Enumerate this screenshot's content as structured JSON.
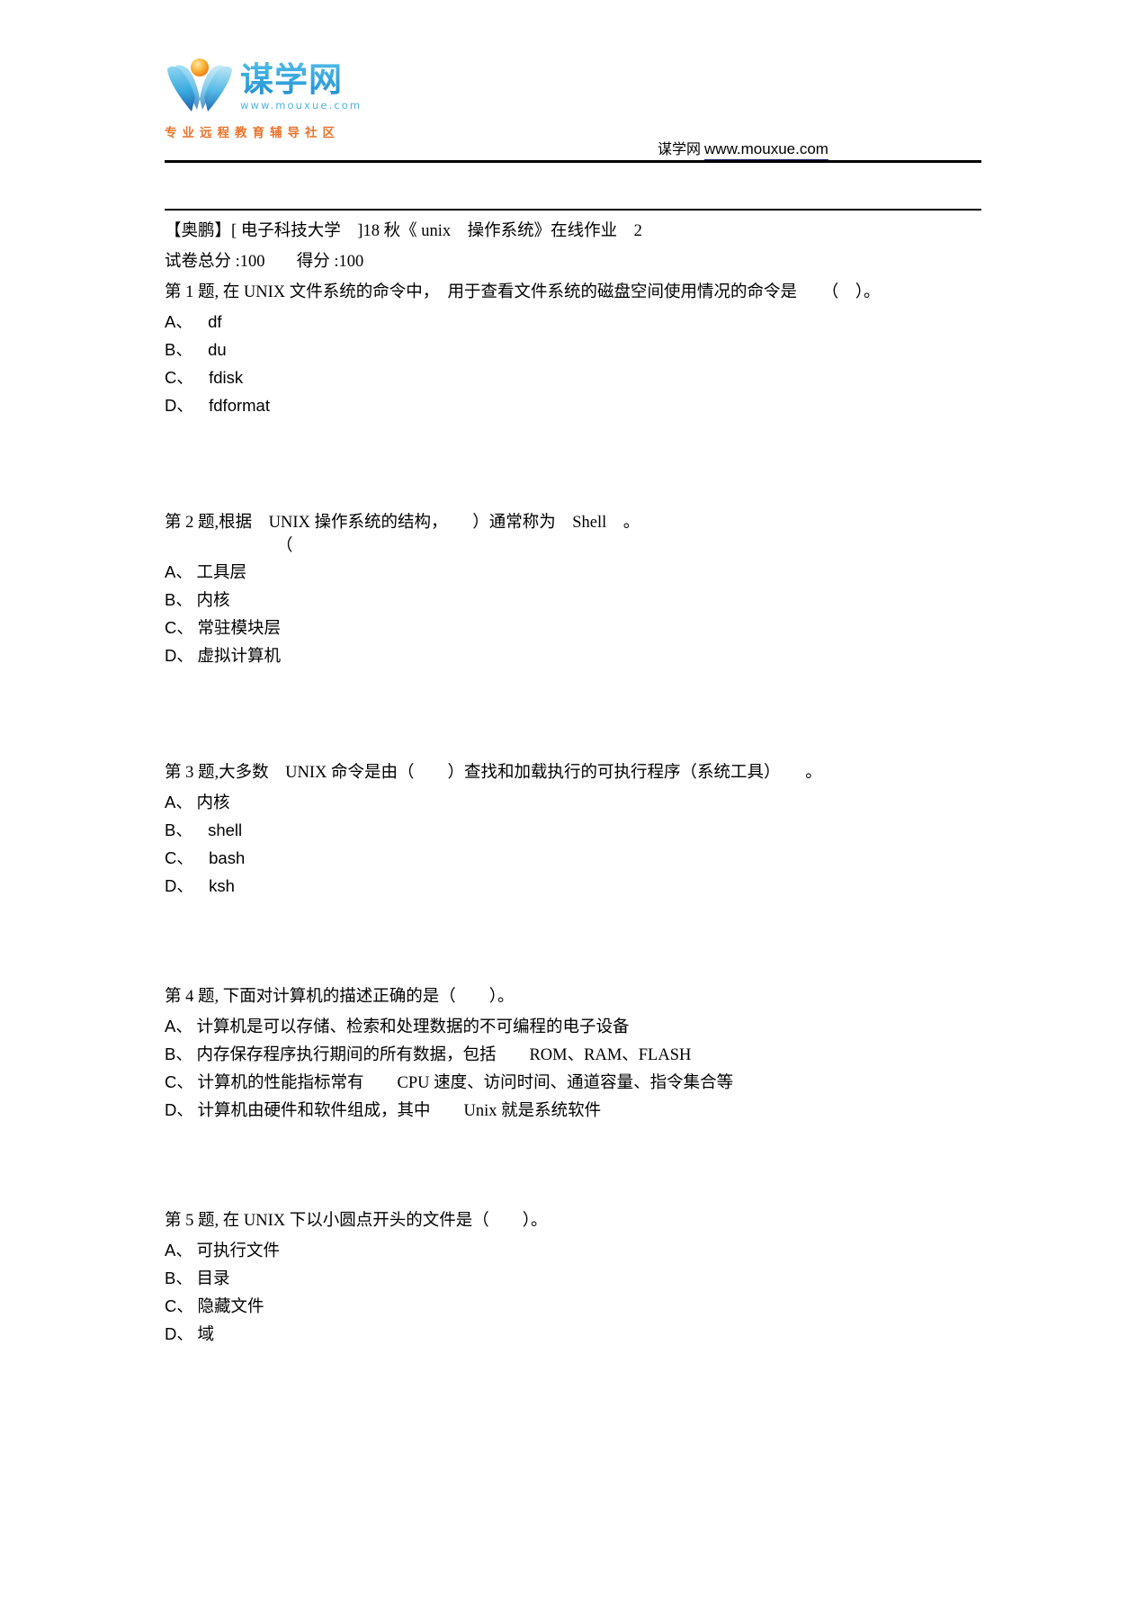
{
  "header": {
    "logo_text": "谋学网",
    "logo_url": "www.mouxue.com",
    "logo_tagline": "专业远程教育辅导社区",
    "right_site_cn": "谋学网",
    "right_site_url": "www.mouxue.com",
    "brand_color": "#29a3dc",
    "tagline_color": "#e8742c",
    "underline_color": "#1d1d6b"
  },
  "doc": {
    "title": "【奥鹏】[ 电子科技大学　]18 秋《 unix　操作系统》在线作业　2",
    "total_label": "试卷总分 :100",
    "gain_label": "得分 :100"
  },
  "questions": [
    {
      "stem": "第 1 题, 在 UNIX 文件系统的命令中，　用于查看文件系统的磁盘空间使用情况的命令是　　（　）。",
      "stem_line2": "",
      "options": [
        {
          "letter": "A、",
          "text": "df"
        },
        {
          "letter": "B、",
          "text": "du"
        },
        {
          "letter": "C、",
          "text": "fdisk"
        },
        {
          "letter": "D、",
          "text": "fdformat"
        }
      ]
    },
    {
      "stem": "第 2 题,根据　UNIX 操作系统的结构，　　）通常称为　Shell　。",
      "stem_line2": "（",
      "options": [
        {
          "letter": "A、",
          "text": "工具层"
        },
        {
          "letter": "B、",
          "text": "内核"
        },
        {
          "letter": "C、",
          "text": "常驻模块层"
        },
        {
          "letter": "D、",
          "text": "虚拟计算机"
        }
      ]
    },
    {
      "stem": "第 3 题,大多数　UNIX 命令是由（　　）查找和加载执行的可执行程序（系统工具）　　。",
      "stem_line2": "",
      "options": [
        {
          "letter": "A、",
          "text": "内核"
        },
        {
          "letter": "B、",
          "text": "shell"
        },
        {
          "letter": "C、",
          "text": "bash"
        },
        {
          "letter": "D、",
          "text": "ksh"
        }
      ]
    },
    {
      "stem": "第 4 题, 下面对计算机的描述正确的是（　　）。",
      "stem_line2": "",
      "options": [
        {
          "letter": "A、",
          "text": "计算机是可以存储、检索和处理数据的不可编程的电子设备"
        },
        {
          "letter": "B、",
          "text": "内存保存程序执行期间的所有数据，包括　　ROM、RAM、FLASH"
        },
        {
          "letter": "C、",
          "text": "计算机的性能指标常有　　CPU 速度、访问时间、通道容量、指令集合等"
        },
        {
          "letter": "D、",
          "text": "计算机由硬件和软件组成，其中　　Unix 就是系统软件"
        }
      ]
    },
    {
      "stem": "第 5 题, 在 UNIX 下以小圆点开头的文件是（　　）。",
      "stem_line2": "",
      "options": [
        {
          "letter": "A、",
          "text": "可执行文件"
        },
        {
          "letter": "B、",
          "text": "目录"
        },
        {
          "letter": "C、",
          "text": "隐藏文件"
        },
        {
          "letter": "D、",
          "text": "域"
        }
      ]
    }
  ]
}
